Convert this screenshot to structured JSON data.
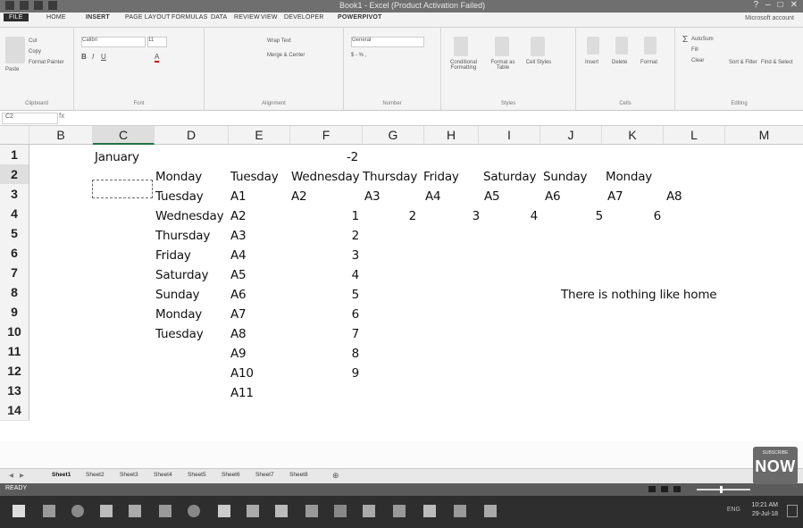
{
  "window": {
    "title": "Book1 - Excel (Product Activation Failed)"
  },
  "ribbon": {
    "tabs": [
      "FILE",
      "HOME",
      "INSERT",
      "PAGE LAYOUT",
      "FORMULAS",
      "DATA",
      "REVIEW",
      "VIEW",
      "DEVELOPER",
      "POWERPIVOT"
    ],
    "user": "Microsoft account",
    "clipboard": {
      "cut": "Cut",
      "copy": "Copy",
      "format_painter": "Format Painter",
      "paste": "Paste",
      "label": "Clipboard"
    },
    "font": {
      "name": "Calibri",
      "size": "11",
      "label": "Font"
    },
    "alignment": {
      "wrap": "Wrap Text",
      "merge": "Merge & Center",
      "label": "Alignment"
    },
    "number": {
      "format": "General",
      "label": "Number"
    },
    "styles": {
      "conditional": "Conditional Formatting",
      "table": "Format as Table",
      "cell": "Cell Styles",
      "label": "Styles"
    },
    "cells": {
      "insert": "Insert",
      "delete": "Delete",
      "format": "Format",
      "label": "Cells"
    },
    "editing": {
      "autosum": "AutoSum",
      "fill": "Fill",
      "clear": "Clear",
      "sort": "Sort & Filter",
      "find": "Find & Select",
      "label": "Editing"
    }
  },
  "formula_bar": {
    "name_box": "C2",
    "fx": "fx",
    "value": ""
  },
  "grid": {
    "columns": [
      "B",
      "C",
      "D",
      "E",
      "F",
      "G",
      "H",
      "I",
      "J",
      "K",
      "L",
      "M"
    ],
    "rows": [
      "1",
      "2",
      "3",
      "4",
      "5",
      "6",
      "7",
      "8",
      "9",
      "10",
      "11",
      "12",
      "13",
      "14"
    ],
    "cells": {
      "c1": "January",
      "f1": "-2",
      "d2": "Monday",
      "e2": "Tuesday",
      "f2": "Wednesday",
      "g2": "Thursday",
      "h2": "Friday",
      "i2": "Saturday",
      "j2": "Sunday",
      "k2": "Monday",
      "d3": "Tuesday",
      "e3": "A1",
      "f3": "A2",
      "g3": "A3",
      "h3": "A4",
      "i3": "A5",
      "j3": "A6",
      "k3": "A7",
      "l3": "A8",
      "d4": "Wednesday",
      "e4": "A2",
      "f4": "1",
      "g4": "2",
      "h4": "3",
      "i4": "4",
      "j4": "5",
      "k4": "6",
      "d5": "Thursday",
      "e5": "A3",
      "f5": "2",
      "d6": "Friday",
      "e6": "A4",
      "f6": "3",
      "d7": "Saturday",
      "e7": "A5",
      "f7": "4",
      "d8": "Sunday",
      "e8": "A6",
      "f8": "5",
      "j8": "There is nothing like home",
      "d9": "Monday",
      "e9": "A7",
      "f9": "6",
      "d10": "Tuesday",
      "e10": "A8",
      "f10": "7",
      "e11": "A9",
      "f11": "8",
      "e12": "A10",
      "f12": "9",
      "e13": "A11"
    }
  },
  "sheets": [
    "Sheet1",
    "Sheet2",
    "Sheet3",
    "Sheet4",
    "Sheet5",
    "Sheet6",
    "Sheet7",
    "Sheet8"
  ],
  "status": {
    "mode": "READY"
  },
  "badge": {
    "sub": "SUBSCRIBE",
    "big": "NOW"
  },
  "taskbar": {
    "clock_time": "10:21 AM",
    "clock_date": "29-Jul-18",
    "tray": "ENG"
  }
}
